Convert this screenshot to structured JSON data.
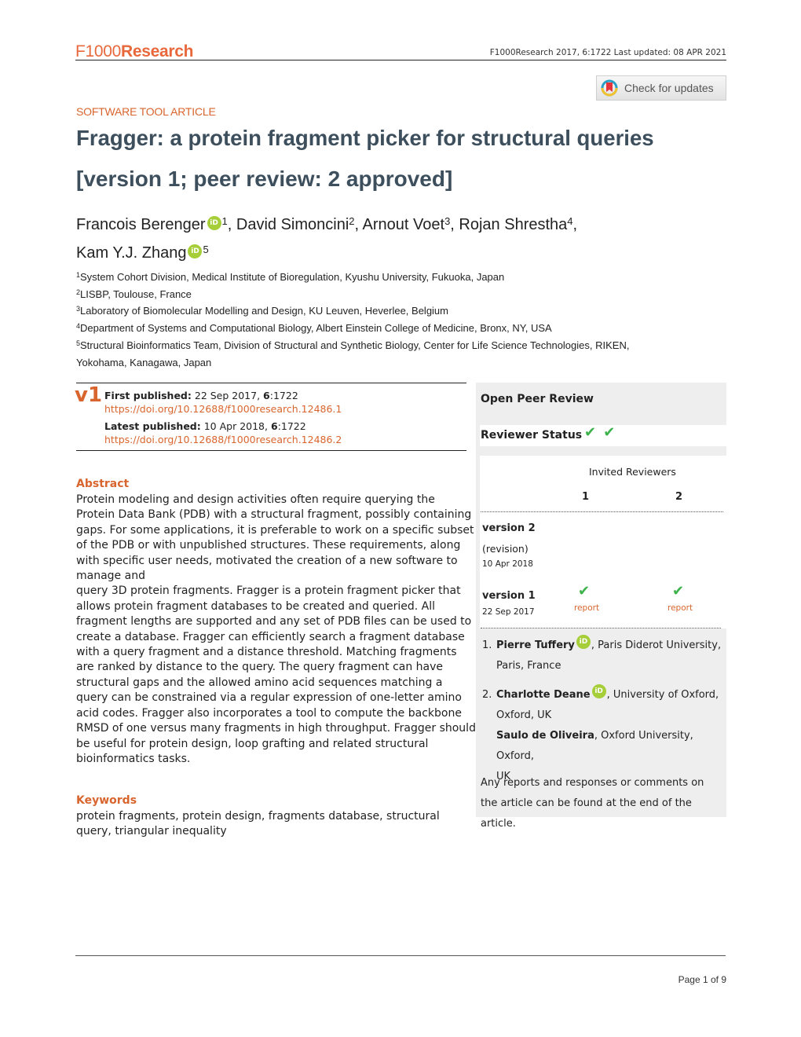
{
  "header": {
    "logo_part1": "F1000",
    "logo_part2": "Research",
    "citation": "F1000Research 2017, 6:1722 Last updated: 08 APR 2021",
    "check_updates_label": "Check for updates",
    "check_updates_icon": "crossmark-icon"
  },
  "article": {
    "type": "SOFTWARE TOOL ARTICLE",
    "title": "Fragger: a protein fragment picker for structural queries",
    "subtitle": "[version 1; peer review: 2 approved]",
    "authors": [
      {
        "name": "Francois Berenger",
        "sup": "1",
        "orcid": true,
        "sep": ", "
      },
      {
        "name": "David Simoncini",
        "sup": "2",
        "orcid": false,
        "sep": ", "
      },
      {
        "name": "Arnout Voet",
        "sup": "3",
        "orcid": false,
        "sep": ", "
      },
      {
        "name": "Rojan Shrestha",
        "sup": "4",
        "orcid": false,
        "sep": ","
      },
      {
        "name": "Kam Y.J. Zhang",
        "sup": "5",
        "orcid": true,
        "sep": ""
      }
    ],
    "orcid_label": "iD",
    "affiliations": [
      {
        "num": "1",
        "text": "System Cohort Division, Medical Institute of Bioregulation, Kyushu University, Fukuoka, Japan"
      },
      {
        "num": "2",
        "text": "LISBP, Toulouse, France"
      },
      {
        "num": "3",
        "text": "Laboratory of Biomolecular Modelling and Design, KU Leuven, Heverlee, Belgium"
      },
      {
        "num": "4",
        "text": "Department of Systems and Computational Biology, Albert Einstein College of Medicine, Bronx, NY, USA"
      },
      {
        "num": "5",
        "text": "Structural Bioinformatics Team, Division of Structural and Synthetic Biology, Center for Life Science Technologies, RIKEN,"
      },
      {
        "num": "",
        "text": "Yokohama, Kanagawa, Japan"
      }
    ]
  },
  "publication": {
    "version_badge": "v1",
    "first_label": "First published:",
    "first_date": " 22 Sep 2017, ",
    "first_vol": "6",
    "first_page": ":1722",
    "first_doi": "https://doi.org/10.12688/f1000research.12486.1",
    "latest_label": "Latest published:",
    "latest_date": " 10 Apr 2018, ",
    "latest_vol": "6",
    "latest_page": ":1722",
    "latest_doi": "https://doi.org/10.12688/f1000research.12486.2"
  },
  "abstract": {
    "heading": "Abstract",
    "text": "Protein modeling and design activities often require querying the Protein Data Bank (PDB) with a structural fragment, possibly containing gaps. For some applications, it is preferable to work on a specific subset of the PDB or with unpublished structures. These requirements, along with specific user needs, motivated the creation of a new software to manage and\nquery 3D protein fragments. Fragger is a protein fragment picker that allows protein fragment databases to be created and queried. All fragment lengths are supported and any set of PDB files can be used to create a database. Fragger can efficiently search a fragment database with a query fragment and a distance threshold. Matching fragments are ranked by distance to the query. The query fragment can have structural gaps and the allowed amino acid sequences matching a query can be constrained via a regular expression of one-letter amino acid codes. Fragger also incorporates a tool to compute the backbone RMSD of one versus many fragments in high throughput. Fragger should be useful for protein design, loop grafting and related structural\nbioinformatics tasks."
  },
  "keywords": {
    "heading": "Keywords",
    "text": "protein fragments, protein design, fragments database, structural query, triangular inequality"
  },
  "peer_review": {
    "title": "Open Peer Review",
    "status_label": "Reviewer Status",
    "status_ticks": [
      "approved",
      "approved"
    ],
    "tick_glyph": "✔",
    "invited_label": "Invited Reviewers",
    "reviewer_columns": [
      "1",
      "2"
    ],
    "versions": [
      {
        "label": "version 2",
        "sub": "(revision)",
        "date": "10 Apr 2018",
        "reports": []
      },
      {
        "label": "version 1",
        "sub": "",
        "date": "22 Sep 2017",
        "reports": [
          "report",
          "report"
        ]
      }
    ],
    "reviewers": [
      {
        "num": "1.",
        "name": "Pierre Tuffery",
        "orcid": true,
        "affil": ", Paris Diderot University,",
        "affil2": "Paris, France"
      },
      {
        "num": "2.",
        "name": "Charlotte Deane",
        "orcid": true,
        "affil": ", University of Oxford,",
        "affil2": "Oxford, UK"
      },
      {
        "num": "",
        "name": "Saulo de Oliveira",
        "orcid": false,
        "affil": ", Oxford University, Oxford,",
        "affil2": "UK"
      }
    ],
    "footer_note": "Any reports and responses or comments on the article can be found at the end of the article."
  },
  "footer": {
    "page": "Page 1 of 9"
  },
  "colors": {
    "brand_orange": "#d9652e",
    "title_slate": "#3d4f5c",
    "orcid_green": "#a6ce39",
    "approved_green": "#3cb34a",
    "panel_grey": "#eeeeee"
  }
}
